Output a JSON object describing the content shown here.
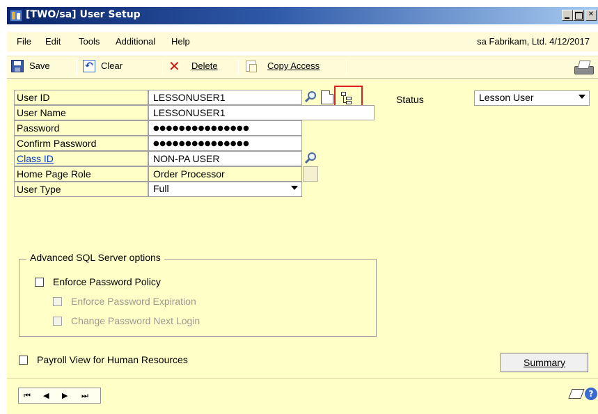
{
  "window": {
    "title": "[TWO/sa] User Setup"
  },
  "menu": {
    "items": [
      "File",
      "Edit",
      "Tools",
      "Additional",
      "Help"
    ],
    "company_info": "sa  Fabrikam, Ltd.  4/12/2017"
  },
  "toolbar": {
    "save_label": "Save",
    "clear_label": "Clear",
    "delete_label": "Delete",
    "copy_access_label": "Copy Access"
  },
  "form": {
    "user_id": {
      "label": "User ID",
      "value": "LESSONUSER1"
    },
    "user_name": {
      "label": "User Name",
      "value": "LESSONUSER1"
    },
    "password": {
      "label": "Password",
      "value": "●●●●●●●●●●●●●●●"
    },
    "confirm_password": {
      "label": "Confirm Password",
      "value": "●●●●●●●●●●●●●●●"
    },
    "class_id": {
      "label": "Class ID",
      "value": "NON-PA USER"
    },
    "home_page_role": {
      "label": "Home Page Role",
      "value": "Order Processor"
    },
    "user_type": {
      "label": "User Type",
      "value": "Full"
    },
    "status": {
      "label": "Status",
      "value": "Lesson User"
    }
  },
  "advanced_sql": {
    "title": "Advanced SQL Server options",
    "enforce_password_policy": "Enforce Password Policy",
    "enforce_password_expiration": "Enforce Password Expiration",
    "change_password_next_login": "Change Password Next Login"
  },
  "payroll_view_label": "Payroll View for Human Resources",
  "summary_button_label": "Summary",
  "icons": {
    "nav_first": "⏮",
    "nav_prev": "◀",
    "nav_next": "▶",
    "nav_last": "⏭"
  },
  "colors": {
    "form_background": "#ffffc8",
    "title_bar": "#0a246a",
    "link": "#0033cc",
    "highlight_box": "#e02020"
  }
}
